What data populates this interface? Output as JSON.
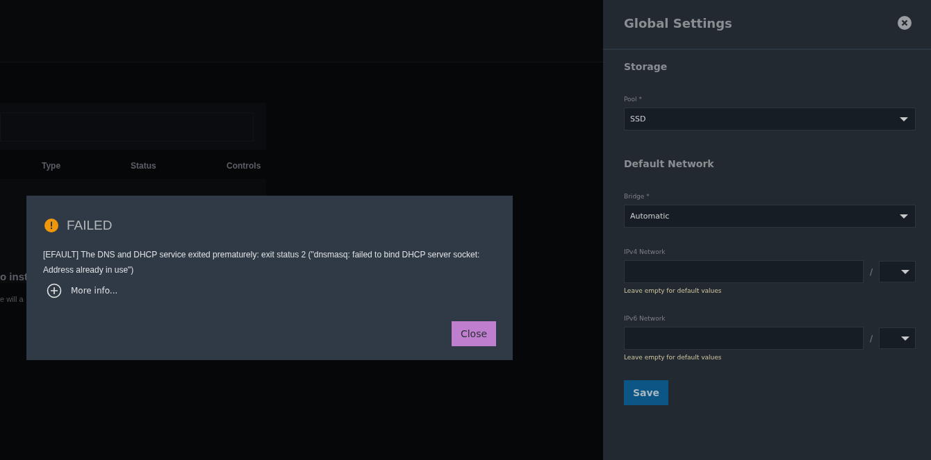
{
  "background": {
    "table_columns": [
      "Type",
      "Status",
      "Controls"
    ],
    "empty_title": "o inst",
    "empty_text": "e will a"
  },
  "dialog": {
    "title": "FAILED",
    "message": "[EFAULT] The DNS and DHCP service exited prematurely: exit status 2 (\"dnsmasq: failed to bind DHCP server socket: Address already in use\")",
    "more_info": "More info...",
    "close_button": "Close"
  },
  "panel": {
    "title": "Global Settings",
    "sections": [
      {
        "heading": "Storage",
        "fields": [
          {
            "kind": "select",
            "label": "Pool *",
            "value": "SSD"
          }
        ]
      },
      {
        "heading": "Default Network",
        "fields": [
          {
            "kind": "select",
            "label": "Bridge *",
            "value": "Automatic"
          },
          {
            "kind": "network",
            "label": "IPv4 Network",
            "separator": "/",
            "hint": "Leave empty for default values"
          },
          {
            "kind": "network",
            "label": "IPv6 Network",
            "separator": "/",
            "hint": "Leave empty for default values"
          }
        ]
      }
    ],
    "save_button": "Save"
  }
}
